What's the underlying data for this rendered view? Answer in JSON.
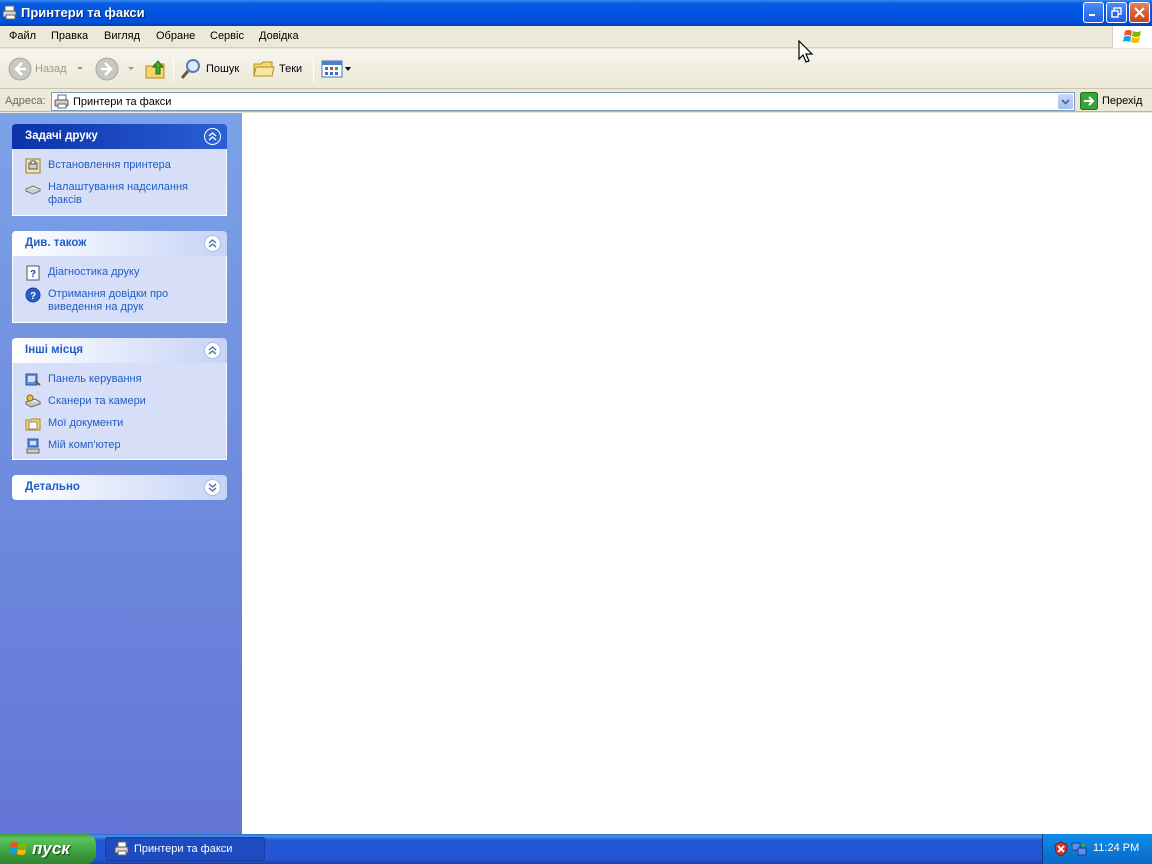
{
  "window": {
    "title": "Принтери та факси",
    "controls": {
      "minimize": "minimize-icon",
      "maximize": "restore-icon",
      "close": "close-icon"
    }
  },
  "menubar": {
    "items": [
      "Файл",
      "Правка",
      "Вигляд",
      "Обране",
      "Сервіс",
      "Довідка"
    ]
  },
  "toolbar": {
    "back_label": "Назад",
    "search_label": "Пошук",
    "folders_label": "Теки"
  },
  "addressbar": {
    "label": "Адреса:",
    "value": "Принтери та факси",
    "go_label": "Перехід"
  },
  "taskpane": {
    "groups": [
      {
        "title": "Задачі друку",
        "links": [
          {
            "label": "Встановлення принтера",
            "icon": "add-printer-icon"
          },
          {
            "label": "Налаштування надсилання факсів",
            "icon": "fax-icon"
          }
        ]
      },
      {
        "title": "Див. також",
        "links": [
          {
            "label": "Діагностика друку",
            "icon": "help-page-icon"
          },
          {
            "label": "Отримання довідки про виведення на друк",
            "icon": "help-circle-icon"
          }
        ]
      },
      {
        "title": "Інші місця",
        "links": [
          {
            "label": "Панель керування",
            "icon": "control-panel-icon"
          },
          {
            "label": "Сканери та камери",
            "icon": "scanner-icon"
          },
          {
            "label": "Мої документи",
            "icon": "my-documents-icon"
          },
          {
            "label": "Мій комп'ютер",
            "icon": "my-computer-icon"
          }
        ]
      },
      {
        "title": "Детально",
        "links": []
      }
    ]
  },
  "taskbar": {
    "start_label": "пуск",
    "task_label": "Принтери та факси",
    "clock": "11:24 PM"
  },
  "colors": {
    "titlebar": "#0054e3",
    "taskpane_link": "#215dc6",
    "start_green": "#3f9f3f"
  }
}
